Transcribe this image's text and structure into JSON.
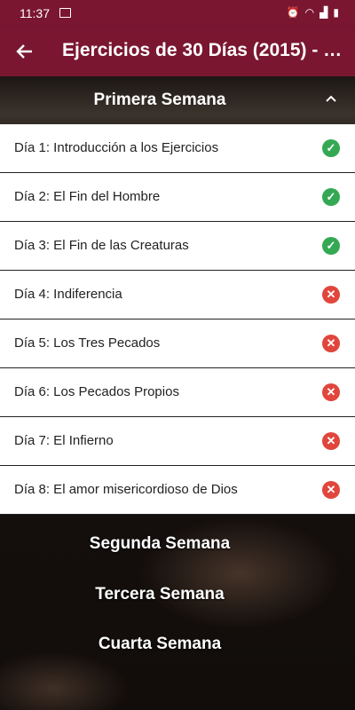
{
  "status": {
    "time": "11:37"
  },
  "appbar": {
    "title": "Ejercicios de 30 Días (2015) - P..."
  },
  "section": {
    "title": "Primera Semana"
  },
  "days": [
    {
      "label": "Día 1: Introducción a los Ejercicios",
      "done": true
    },
    {
      "label": "Día 2: El Fin del Hombre",
      "done": true
    },
    {
      "label": "Día 3: El Fin de las Creaturas",
      "done": true
    },
    {
      "label": "Día 4: Indiferencia",
      "done": false
    },
    {
      "label": "Día 5: Los Tres Pecados",
      "done": false
    },
    {
      "label": "Día 6: Los Pecados Propios",
      "done": false
    },
    {
      "label": "Día 7: El Infierno",
      "done": false
    },
    {
      "label": "Día 8: El amor misericordioso de Dios",
      "done": false
    }
  ],
  "weeks": [
    "Segunda Semana",
    "Tercera Semana",
    "Cuarta Semana"
  ],
  "colors": {
    "primary": "#7a1630",
    "done": "#34a853",
    "pending": "#e0463c"
  },
  "icons": {
    "back": "arrow-left-icon",
    "collapse": "chevron-up-icon",
    "done": "check-circle-icon",
    "pending": "x-circle-icon"
  }
}
